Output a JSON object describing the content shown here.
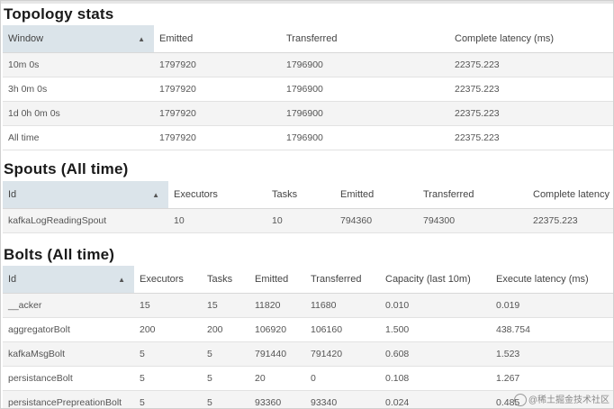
{
  "topology": {
    "title": "Topology stats",
    "headers": [
      "Window",
      "Emitted",
      "Transferred",
      "Complete latency (ms)"
    ],
    "rows": [
      [
        "10m 0s",
        "1797920",
        "1796900",
        "22375.223"
      ],
      [
        "3h 0m 0s",
        "1797920",
        "1796900",
        "22375.223"
      ],
      [
        "1d 0h 0m 0s",
        "1797920",
        "1796900",
        "22375.223"
      ],
      [
        "All time",
        "1797920",
        "1796900",
        "22375.223"
      ]
    ]
  },
  "spouts": {
    "title": "Spouts (All time)",
    "headers": [
      "Id",
      "Executors",
      "Tasks",
      "Emitted",
      "Transferred",
      "Complete latency"
    ],
    "rows": [
      [
        "kafkaLogReadingSpout",
        "10",
        "10",
        "794360",
        "794300",
        "22375.223"
      ]
    ]
  },
  "bolts": {
    "title": "Bolts (All time)",
    "headers": [
      "Id",
      "Executors",
      "Tasks",
      "Emitted",
      "Transferred",
      "Capacity (last 10m)",
      "Execute latency (ms)"
    ],
    "rows": [
      [
        "__acker",
        "15",
        "15",
        "11820",
        "11680",
        "0.010",
        "0.019"
      ],
      [
        "aggregatorBolt",
        "200",
        "200",
        "106920",
        "106160",
        "1.500",
        "438.754"
      ],
      [
        "kafkaMsgBolt",
        "5",
        "5",
        "791440",
        "791420",
        "0.608",
        "1.523"
      ],
      [
        "persistanceBolt",
        "5",
        "5",
        "20",
        "0",
        "0.108",
        "1.267"
      ],
      [
        "persistancePrepreationBolt",
        "5",
        "5",
        "93360",
        "93340",
        "0.024",
        "0.485"
      ]
    ]
  },
  "watermark": {
    "text": "@稀土掘金技术社区",
    "icon": "circle-logo-icon"
  }
}
